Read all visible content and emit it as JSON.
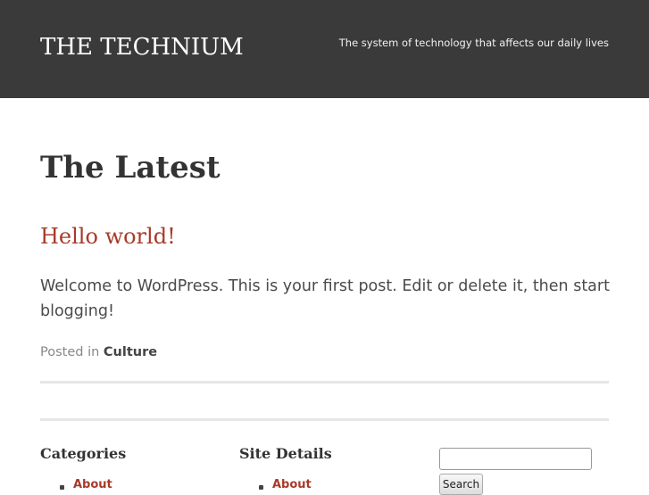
{
  "header": {
    "site_title": "THE TECHNIUM",
    "tagline": "The system of technology that affects our daily lives",
    "background_color": "#3a3a3a"
  },
  "main": {
    "heading": "The Latest",
    "post": {
      "title": "Hello world!",
      "body": "Welcome to WordPress. This is your first post. Edit or delete it, then start blogging!",
      "meta_prefix": "Posted in",
      "category": "Culture"
    },
    "link_color": "#a83a2a"
  },
  "footer_widgets": {
    "categories": {
      "title": "Categories",
      "items": [
        "About"
      ]
    },
    "site_details": {
      "title": "Site Details",
      "items": [
        "About"
      ]
    },
    "search": {
      "input_value": "",
      "button_label": "Search"
    }
  }
}
